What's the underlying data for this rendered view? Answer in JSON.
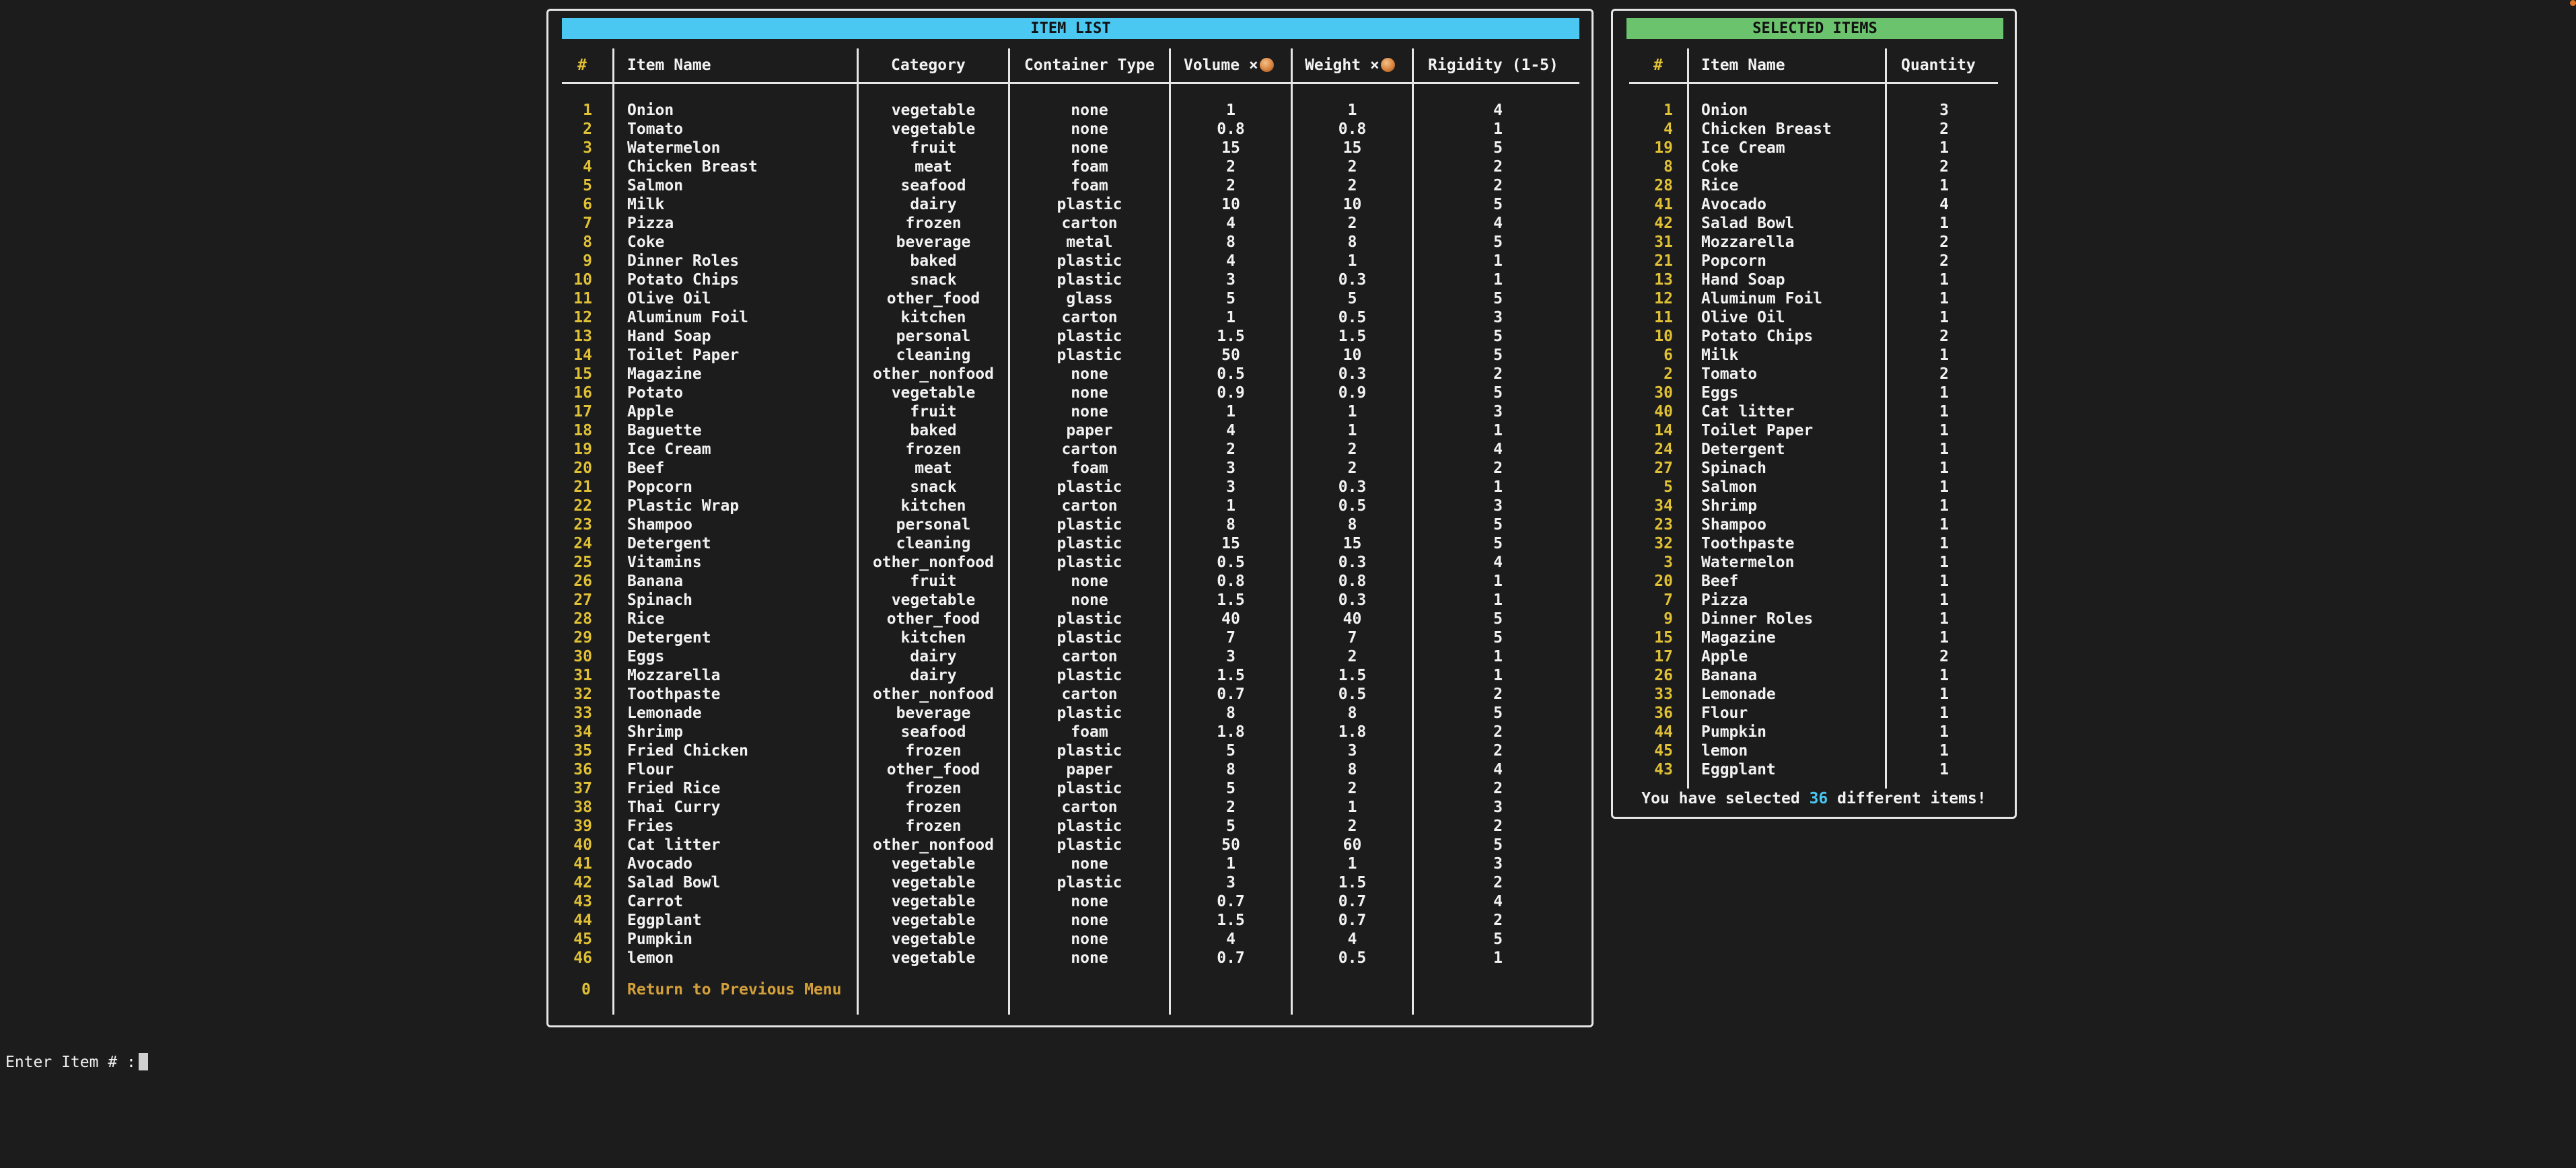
{
  "item_list": {
    "title": "ITEM LIST",
    "headers": {
      "index": "#",
      "name": "Item Name",
      "category": "Category",
      "container": "Container Type",
      "volume": "Volume ×",
      "weight": "Weight ×",
      "rigidity": "Rigidity (1-5)"
    },
    "rows": [
      [
        "1",
        "Onion",
        "vegetable",
        "none",
        "1",
        "1",
        "4"
      ],
      [
        "2",
        "Tomato",
        "vegetable",
        "none",
        "0.8",
        "0.8",
        "1"
      ],
      [
        "3",
        "Watermelon",
        "fruit",
        "none",
        "15",
        "15",
        "5"
      ],
      [
        "4",
        "Chicken Breast",
        "meat",
        "foam",
        "2",
        "2",
        "2"
      ],
      [
        "5",
        "Salmon",
        "seafood",
        "foam",
        "2",
        "2",
        "2"
      ],
      [
        "6",
        "Milk",
        "dairy",
        "plastic",
        "10",
        "10",
        "5"
      ],
      [
        "7",
        "Pizza",
        "frozen",
        "carton",
        "4",
        "2",
        "4"
      ],
      [
        "8",
        "Coke",
        "beverage",
        "metal",
        "8",
        "8",
        "5"
      ],
      [
        "9",
        "Dinner Roles",
        "baked",
        "plastic",
        "4",
        "1",
        "1"
      ],
      [
        "10",
        "Potato Chips",
        "snack",
        "plastic",
        "3",
        "0.3",
        "1"
      ],
      [
        "11",
        "Olive Oil",
        "other_food",
        "glass",
        "5",
        "5",
        "5"
      ],
      [
        "12",
        "Aluminum Foil",
        "kitchen",
        "carton",
        "1",
        "0.5",
        "3"
      ],
      [
        "13",
        "Hand Soap",
        "personal",
        "plastic",
        "1.5",
        "1.5",
        "5"
      ],
      [
        "14",
        "Toilet Paper",
        "cleaning",
        "plastic",
        "50",
        "10",
        "5"
      ],
      [
        "15",
        "Magazine",
        "other_nonfood",
        "none",
        "0.5",
        "0.3",
        "2"
      ],
      [
        "16",
        "Potato",
        "vegetable",
        "none",
        "0.9",
        "0.9",
        "5"
      ],
      [
        "17",
        "Apple",
        "fruit",
        "none",
        "1",
        "1",
        "3"
      ],
      [
        "18",
        "Baguette",
        "baked",
        "paper",
        "4",
        "1",
        "1"
      ],
      [
        "19",
        "Ice Cream",
        "frozen",
        "carton",
        "2",
        "2",
        "4"
      ],
      [
        "20",
        "Beef",
        "meat",
        "foam",
        "3",
        "2",
        "2"
      ],
      [
        "21",
        "Popcorn",
        "snack",
        "plastic",
        "3",
        "0.3",
        "1"
      ],
      [
        "22",
        "Plastic Wrap",
        "kitchen",
        "carton",
        "1",
        "0.5",
        "3"
      ],
      [
        "23",
        "Shampoo",
        "personal",
        "plastic",
        "8",
        "8",
        "5"
      ],
      [
        "24",
        "Detergent",
        "cleaning",
        "plastic",
        "15",
        "15",
        "5"
      ],
      [
        "25",
        "Vitamins",
        "other_nonfood",
        "plastic",
        "0.5",
        "0.3",
        "4"
      ],
      [
        "26",
        "Banana",
        "fruit",
        "none",
        "0.8",
        "0.8",
        "1"
      ],
      [
        "27",
        "Spinach",
        "vegetable",
        "none",
        "1.5",
        "0.3",
        "1"
      ],
      [
        "28",
        "Rice",
        "other_food",
        "plastic",
        "40",
        "40",
        "5"
      ],
      [
        "29",
        "Detergent",
        "kitchen",
        "plastic",
        "7",
        "7",
        "5"
      ],
      [
        "30",
        "Eggs",
        "dairy",
        "carton",
        "3",
        "2",
        "1"
      ],
      [
        "31",
        "Mozzarella",
        "dairy",
        "plastic",
        "1.5",
        "1.5",
        "1"
      ],
      [
        "32",
        "Toothpaste",
        "other_nonfood",
        "carton",
        "0.7",
        "0.5",
        "2"
      ],
      [
        "33",
        "Lemonade",
        "beverage",
        "plastic",
        "8",
        "8",
        "5"
      ],
      [
        "34",
        "Shrimp",
        "seafood",
        "foam",
        "1.8",
        "1.8",
        "2"
      ],
      [
        "35",
        "Fried Chicken",
        "frozen",
        "plastic",
        "5",
        "3",
        "2"
      ],
      [
        "36",
        "Flour",
        "other_food",
        "paper",
        "8",
        "8",
        "4"
      ],
      [
        "37",
        "Fried Rice",
        "frozen",
        "plastic",
        "5",
        "2",
        "2"
      ],
      [
        "38",
        "Thai Curry",
        "frozen",
        "carton",
        "2",
        "1",
        "3"
      ],
      [
        "39",
        "Fries",
        "frozen",
        "plastic",
        "5",
        "2",
        "2"
      ],
      [
        "40",
        "Cat litter",
        "other_nonfood",
        "plastic",
        "50",
        "60",
        "5"
      ],
      [
        "41",
        "Avocado",
        "vegetable",
        "none",
        "1",
        "1",
        "3"
      ],
      [
        "42",
        "Salad Bowl",
        "vegetable",
        "plastic",
        "3",
        "1.5",
        "2"
      ],
      [
        "43",
        "Carrot",
        "vegetable",
        "none",
        "0.7",
        "0.7",
        "4"
      ],
      [
        "44",
        "Eggplant",
        "vegetable",
        "none",
        "1.5",
        "0.7",
        "2"
      ],
      [
        "45",
        "Pumpkin",
        "vegetable",
        "none",
        "4",
        "4",
        "5"
      ],
      [
        "46",
        "lemon",
        "vegetable",
        "none",
        "0.7",
        "0.5",
        "1"
      ]
    ],
    "return_index": "0",
    "return_label": "Return to Previous Menu"
  },
  "selected": {
    "title": "SELECTED ITEMS",
    "headers": {
      "index": "#",
      "name": "Item Name",
      "quantity": "Quantity"
    },
    "rows": [
      [
        "1",
        "Onion",
        "3"
      ],
      [
        "4",
        "Chicken Breast",
        "2"
      ],
      [
        "19",
        "Ice Cream",
        "1"
      ],
      [
        "8",
        "Coke",
        "2"
      ],
      [
        "28",
        "Rice",
        "1"
      ],
      [
        "41",
        "Avocado",
        "4"
      ],
      [
        "42",
        "Salad Bowl",
        "1"
      ],
      [
        "31",
        "Mozzarella",
        "2"
      ],
      [
        "21",
        "Popcorn",
        "2"
      ],
      [
        "13",
        "Hand Soap",
        "1"
      ],
      [
        "12",
        "Aluminum Foil",
        "1"
      ],
      [
        "11",
        "Olive Oil",
        "1"
      ],
      [
        "10",
        "Potato Chips",
        "2"
      ],
      [
        "6",
        "Milk",
        "1"
      ],
      [
        "2",
        "Tomato",
        "2"
      ],
      [
        "30",
        "Eggs",
        "1"
      ],
      [
        "40",
        "Cat litter",
        "1"
      ],
      [
        "14",
        "Toilet Paper",
        "1"
      ],
      [
        "24",
        "Detergent",
        "1"
      ],
      [
        "27",
        "Spinach",
        "1"
      ],
      [
        "5",
        "Salmon",
        "1"
      ],
      [
        "34",
        "Shrimp",
        "1"
      ],
      [
        "23",
        "Shampoo",
        "1"
      ],
      [
        "32",
        "Toothpaste",
        "1"
      ],
      [
        "3",
        "Watermelon",
        "1"
      ],
      [
        "20",
        "Beef",
        "1"
      ],
      [
        "7",
        "Pizza",
        "1"
      ],
      [
        "9",
        "Dinner Roles",
        "1"
      ],
      [
        "15",
        "Magazine",
        "1"
      ],
      [
        "17",
        "Apple",
        "2"
      ],
      [
        "26",
        "Banana",
        "1"
      ],
      [
        "33",
        "Lemonade",
        "1"
      ],
      [
        "36",
        "Flour",
        "1"
      ],
      [
        "44",
        "Pumpkin",
        "1"
      ],
      [
        "45",
        "lemon",
        "1"
      ],
      [
        "43",
        "Eggplant",
        "1"
      ]
    ],
    "footer_prefix": "You have selected",
    "footer_count": "36",
    "footer_suffix": "different items!"
  },
  "prompt": {
    "label": "Enter Item # :"
  },
  "icons": {
    "unit_icon": "onion-icon",
    "accent_blue": "#4bc8f2",
    "accent_green": "#6cc36d",
    "accent_yellow": "#e0c034"
  }
}
